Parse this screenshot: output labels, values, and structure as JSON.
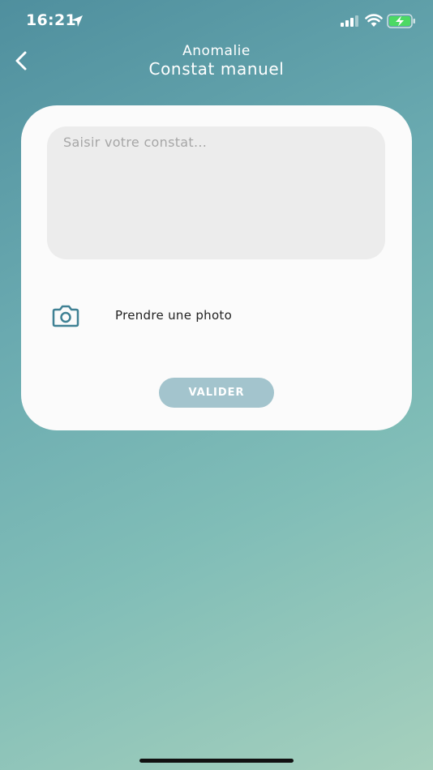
{
  "status_bar": {
    "time": "16:21",
    "icons": [
      "location-arrow-icon",
      "cellular-signal-icon",
      "wifi-icon",
      "battery-charging-icon"
    ]
  },
  "header": {
    "back_icon": "chevron-left-icon",
    "title": "Anomalie",
    "subtitle": "Constat manuel"
  },
  "form": {
    "constat_placeholder": "Saisir votre constat...",
    "constat_value": "",
    "photo_icon": "camera-icon",
    "photo_label": "Prendre une photo",
    "submit_label": "VALIDER"
  },
  "colors": {
    "background_start": "#4f8f9e",
    "background_end": "#a6d0bd",
    "card": "#fbfbfb",
    "input_bg": "#ececec",
    "accent": "#3f8194",
    "button_disabled": "#a3c4cd",
    "battery_charging": "#4cd964"
  }
}
